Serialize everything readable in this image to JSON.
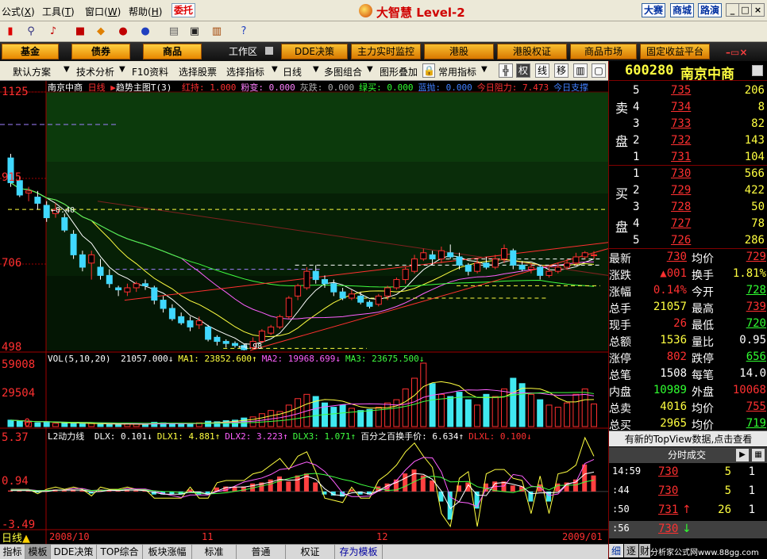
{
  "menubar": {
    "items": [
      "公式",
      "工具",
      "窗口",
      "帮助"
    ],
    "entrust": "委托",
    "brand": "大智慧 Level-2",
    "contest": "大赛",
    "mall": "商城",
    "roadshow": "路演"
  },
  "tabs": {
    "fund": "基金",
    "bond": "债券",
    "commodity": "商品",
    "workarea": "工作区",
    "dde": "DDE决策",
    "monitor": "主力实时监控",
    "hk": "港股",
    "hk_warrant": "港股权证",
    "market": "商品市场",
    "fixed": "固定收益平台"
  },
  "subbar": {
    "default_scheme": "默认方案",
    "tech": "技术分析",
    "f10": "F10资料",
    "select_stock": "选择股票",
    "select_indicator": "选择指标",
    "period": "日线",
    "multi": "多图组合",
    "overlay": "图形叠加",
    "common": "常用指标",
    "rights": "权",
    "line": "线",
    "move": "移"
  },
  "chart": {
    "price_title": "南京中商",
    "price_period": "日线",
    "main_indicator": "趋势主图T(3)",
    "main_values": [
      {
        "label": "红持: 1.000",
        "color": "#ff3030"
      },
      {
        "label": "粉变: 0.000",
        "color": "#ff80ff"
      },
      {
        "label": "灰跌: 0.000",
        "color": "#b0b0b0"
      },
      {
        "label": "绿买: 0.000",
        "color": "#30ff30"
      },
      {
        "label": "蓝抛: 0.000",
        "color": "#4080ff"
      },
      {
        "label": "今日阻力: 7.473",
        "color": "#ff3030"
      },
      {
        "label": "今日支撑",
        "color": "#4080ff"
      }
    ],
    "price_axis": [
      "1125",
      "915",
      "706",
      "498"
    ],
    "annot_high": "8.40",
    "annot_low": "4.98",
    "vol_title": "VOL(5,10,20)",
    "vol_values": [
      {
        "label": "21057.000↓",
        "color": "#ffffff"
      },
      {
        "label": "MA1: 23852.600↑",
        "color": "#ffff40"
      },
      {
        "label": "MA2: 19968.699↓",
        "color": "#ff60ff"
      },
      {
        "label": "MA3: 23675.500↓",
        "color": "#40ff40"
      }
    ],
    "vol_axis": [
      "59008",
      "29504",
      "0"
    ],
    "l2_title": "L2动力线",
    "l2_values": [
      {
        "label": "DLX: 0.101↓",
        "color": "#ffffff"
      },
      {
        "label": "DLX1: 4.881↑",
        "color": "#ffff40"
      },
      {
        "label": "DLX2: 3.223↑",
        "color": "#ff60ff"
      },
      {
        "label": "DLX3: 1.071↑",
        "color": "#40ff40"
      },
      {
        "label": "百分之百换手价: 6.634↑",
        "color": "#ffffff"
      },
      {
        "label": "DLXL: 0.100↓",
        "color": "#ff3030"
      }
    ],
    "l2_axis": [
      "5.37",
      "0.94",
      "-3.49"
    ],
    "date_labels": [
      "2008/10",
      "11",
      "12",
      "2009/01"
    ],
    "period_badge": "日线"
  },
  "right": {
    "code": "600280",
    "name": "南京中商",
    "sell_label": [
      "卖",
      "盘"
    ],
    "buy_label": [
      "买",
      "盘"
    ],
    "asks": [
      {
        "lvl": "5",
        "price": "735",
        "vol": "206"
      },
      {
        "lvl": "4",
        "price": "734",
        "vol": "8"
      },
      {
        "lvl": "3",
        "price": "733",
        "vol": "82"
      },
      {
        "lvl": "2",
        "price": "732",
        "vol": "143"
      },
      {
        "lvl": "1",
        "price": "731",
        "vol": "104"
      }
    ],
    "bids": [
      {
        "lvl": "1",
        "price": "730",
        "vol": "566"
      },
      {
        "lvl": "2",
        "price": "729",
        "vol": "422"
      },
      {
        "lvl": "3",
        "price": "728",
        "vol": "50"
      },
      {
        "lvl": "4",
        "price": "727",
        "vol": "78"
      },
      {
        "lvl": "5",
        "price": "726",
        "vol": "286"
      }
    ],
    "stats": [
      {
        "k1": "最新",
        "v1": "730",
        "c1": "#ff3030",
        "k2": "均价",
        "v2": "729",
        "c2": "#ff3030"
      },
      {
        "k1": "涨跌",
        "v1": "▲001",
        "c1": "#ff3030",
        "k2": "换手",
        "v2": "1.81%",
        "c2": "#ffff40"
      },
      {
        "k1": "涨幅",
        "v1": "0.14%",
        "c1": "#ff3030",
        "k2": "今开",
        "v2": "728",
        "c2": "#30ff30"
      },
      {
        "k1": "总手",
        "v1": "21057",
        "c1": "#ffff40",
        "k2": "最高",
        "v2": "739",
        "c2": "#ff3030"
      },
      {
        "k1": "现手",
        "v1": "26",
        "c1": "#ff3030",
        "k2": "最低",
        "v2": "720",
        "c2": "#30ff30"
      },
      {
        "k1": "总额",
        "v1": "1536",
        "c1": "#ffff40",
        "k2": "量比",
        "v2": "0.95",
        "c2": "#ffffff"
      },
      {
        "k1": "涨停",
        "v1": "802",
        "c1": "#ff3030",
        "k2": "跌停",
        "v2": "656",
        "c2": "#30ff30"
      },
      {
        "k1": "总笔",
        "v1": "1508",
        "c1": "#ffffff",
        "k2": "每笔",
        "v2": "14.0",
        "c2": "#ffffff"
      },
      {
        "k1": "内盘",
        "v1": "10989",
        "c1": "#30ff30",
        "k2": "外盘",
        "v2": "10068",
        "c2": "#ff3030"
      },
      {
        "k1": "总卖",
        "v1": "4016",
        "c1": "#ffff40",
        "k2": "均价",
        "v2": "755",
        "c2": "#ff3030"
      },
      {
        "k1": "总买",
        "v1": "2965",
        "c1": "#ffff40",
        "k2": "均价",
        "v2": "719",
        "c2": "#30ff30"
      }
    ],
    "notice": "有新的TopView数据,点击查看",
    "ticks_title": "分时成交",
    "ticks": [
      {
        "time": "14:59",
        "price": "730",
        "vol": "5",
        "n": "1",
        "arrow": ""
      },
      {
        "time": ":44",
        "price": "730",
        "vol": "5",
        "n": "1",
        "arrow": ""
      },
      {
        "time": ":50",
        "price": "731",
        "vol": "26",
        "n": "1",
        "arrow": "↑"
      },
      {
        "time": ":56",
        "price": "730",
        "vol": "",
        "n": "",
        "arrow": "↓"
      }
    ],
    "bottom_tabs": [
      "细",
      "逐",
      "财"
    ],
    "link": "分析家公式网www.88gg.com"
  },
  "bottom_tabs": [
    "指标",
    "模板",
    "DDE决策",
    "TOP综合",
    "板块涨幅",
    "标准",
    "普通",
    "权证",
    "存为模板"
  ],
  "chart_data": {
    "type": "candlestick",
    "price_range": [
      4.98,
      11.25
    ],
    "candles": [
      [
        9.65,
        9.05,
        9.75,
        8.95
      ],
      [
        9.1,
        8.75,
        9.2,
        8.7
      ],
      [
        8.8,
        8.85,
        8.95,
        8.6
      ],
      [
        8.7,
        8.55,
        8.85,
        8.4
      ],
      [
        8.5,
        8.2,
        8.6,
        8.1
      ],
      [
        8.3,
        8.4,
        8.55,
        8.2
      ],
      [
        8.2,
        7.9,
        8.3,
        7.85
      ],
      [
        7.8,
        7.3,
        7.9,
        7.2
      ],
      [
        7.3,
        7.0,
        7.4,
        6.9
      ],
      [
        7.1,
        7.3,
        7.4,
        6.7
      ],
      [
        7.0,
        6.8,
        7.2,
        6.7
      ],
      [
        6.8,
        6.6,
        6.95,
        6.5
      ],
      [
        6.5,
        6.45,
        6.55,
        6.3
      ],
      [
        6.4,
        6.5,
        6.6,
        6.3
      ],
      [
        6.5,
        6.6,
        6.65,
        6.4
      ],
      [
        6.6,
        6.55,
        6.7,
        6.45
      ],
      [
        6.5,
        6.2,
        6.55,
        6.1
      ],
      [
        6.2,
        6.0,
        6.3,
        5.9
      ],
      [
        6.0,
        5.75,
        6.1,
        5.7
      ],
      [
        5.8,
        5.65,
        5.9,
        5.6
      ],
      [
        5.7,
        5.55,
        5.8,
        5.45
      ],
      [
        5.6,
        5.7,
        5.8,
        5.5
      ],
      [
        5.55,
        5.25,
        5.6,
        5.2
      ],
      [
        5.3,
        5.2,
        5.35,
        5.1
      ],
      [
        5.2,
        5.15,
        5.25,
        5.05
      ],
      [
        5.15,
        5.1,
        5.2,
        5.05
      ],
      [
        5.1,
        5.0,
        5.15,
        4.98
      ],
      [
        5.05,
        5.2,
        5.3,
        5.0
      ],
      [
        5.2,
        5.45,
        5.5,
        5.15
      ],
      [
        5.4,
        5.55,
        5.6,
        5.35
      ],
      [
        5.55,
        5.8,
        5.85,
        5.5
      ],
      [
        5.8,
        6.25,
        6.3,
        5.75
      ],
      [
        6.3,
        6.55,
        6.6,
        6.2
      ],
      [
        6.5,
        6.9,
        7.0,
        6.45
      ],
      [
        6.9,
        6.7,
        7.05,
        6.6
      ],
      [
        6.7,
        6.6,
        6.8,
        6.5
      ],
      [
        6.6,
        6.4,
        6.7,
        6.3
      ],
      [
        6.4,
        6.25,
        6.5,
        6.2
      ],
      [
        6.25,
        6.35,
        6.45,
        6.2
      ],
      [
        6.3,
        6.15,
        6.4,
        6.1
      ],
      [
        6.15,
        6.05,
        6.2,
        6.0
      ],
      [
        6.1,
        6.3,
        6.35,
        6.05
      ],
      [
        6.3,
        6.5,
        6.55,
        6.2
      ],
      [
        6.5,
        6.7,
        6.75,
        6.45
      ],
      [
        6.7,
        6.95,
        7.0,
        6.6
      ],
      [
        6.9,
        7.2,
        7.3,
        6.85
      ],
      [
        7.2,
        7.35,
        7.45,
        7.15
      ],
      [
        7.3,
        7.2,
        7.4,
        7.05
      ],
      [
        7.2,
        7.4,
        7.5,
        7.1
      ],
      [
        7.35,
        7.25,
        7.55,
        7.2
      ],
      [
        7.25,
        7.05,
        7.35,
        6.95
      ],
      [
        7.05,
        6.9,
        7.1,
        6.8
      ],
      [
        6.9,
        7.1,
        7.2,
        6.85
      ],
      [
        7.1,
        7.0,
        7.25,
        6.95
      ],
      [
        7.0,
        7.2,
        7.3,
        6.95
      ],
      [
        7.2,
        7.45,
        7.55,
        7.1
      ],
      [
        7.4,
        7.05,
        7.45,
        6.95
      ],
      [
        7.05,
        6.95,
        7.15,
        6.9
      ],
      [
        6.95,
        7.0,
        7.1,
        6.85
      ],
      [
        7.0,
        6.8,
        7.05,
        6.7
      ],
      [
        6.8,
        6.9,
        7.0,
        6.75
      ],
      [
        6.9,
        7.0,
        7.1,
        6.85
      ],
      [
        7.0,
        7.1,
        7.2,
        6.95
      ],
      [
        7.1,
        7.25,
        7.35,
        7.05
      ],
      [
        7.25,
        7.35,
        7.39,
        7.2
      ],
      [
        7.28,
        7.3,
        7.39,
        7.2
      ]
    ],
    "volume_range": [
      0,
      59008
    ],
    "volumes": [
      6000,
      5000,
      4000,
      3500,
      4500,
      3000,
      3200,
      2800,
      2500,
      3000,
      2200,
      2000,
      1800,
      2500,
      2400,
      2100,
      4000,
      3500,
      3000,
      2800,
      2600,
      3500,
      5000,
      4500,
      5500,
      6000,
      8000,
      9000,
      12000,
      15000,
      14000,
      20000,
      26000,
      30000,
      28000,
      22000,
      18000,
      20000,
      17000,
      15000,
      16000,
      18000,
      22000,
      25000,
      35000,
      45000,
      59008,
      40000,
      30000,
      28000,
      32000,
      25000,
      20000,
      30000,
      28000,
      35000,
      45000,
      40000,
      30000,
      25000,
      20000,
      18000,
      22000,
      30000,
      35000,
      21057
    ],
    "l2_range": [
      -3.49,
      5.37
    ],
    "dlxl": [
      0.1,
      0.1,
      0.1,
      -0.1,
      0.1,
      0.2,
      0.1,
      0.2,
      0.1,
      -0.2,
      0.2,
      0.1,
      0.1,
      0.2,
      0.1,
      0.1,
      -0.3,
      -0.3,
      -0.3,
      -0.3,
      0.2,
      -0.3,
      -0.3,
      0.4,
      0.5,
      0.5,
      0.5,
      0.8,
      0.9,
      1.2,
      1.5,
      1.0,
      1.6,
      1.8,
      0.9,
      -0.3,
      -0.4,
      -0.5,
      0.2,
      -0.3,
      -0.3,
      0.5,
      0.8,
      1.2,
      1.8,
      2.2,
      1.6,
      1.1,
      -1.0,
      -2.8,
      0.6,
      0.9,
      -1.7,
      0.8,
      1.0,
      1.0,
      0.6,
      0.5,
      -1.0,
      0.7,
      -1.0,
      0.8,
      0.9,
      1.2,
      2.7,
      1.6
    ]
  }
}
